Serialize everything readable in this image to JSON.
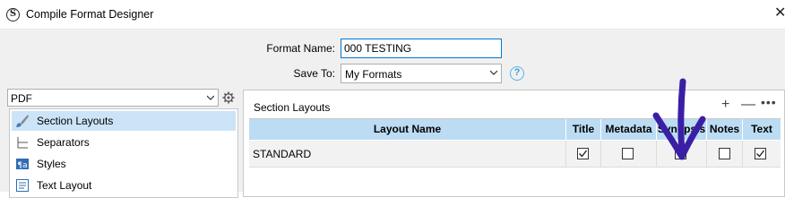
{
  "window": {
    "title": "Compile Format Designer",
    "app_icon": "scrivener-logo",
    "close_icon": "close-icon"
  },
  "form": {
    "format_name_label": "Format Name:",
    "format_name_value": "000 TESTING",
    "save_to_label": "Save To:",
    "save_to_value": "My Formats",
    "help_icon": "?"
  },
  "left": {
    "output_select_value": "PDF",
    "items": [
      {
        "label": "Section Layouts",
        "icon": "brush-icon",
        "selected": true
      },
      {
        "label": "Separators",
        "icon": "separator-icon",
        "selected": false
      },
      {
        "label": "Styles",
        "icon": "styles-icon",
        "selected": false
      },
      {
        "label": "Text Layout",
        "icon": "text-layout-icon",
        "selected": false
      }
    ]
  },
  "right": {
    "title": "Section Layouts",
    "add_label": "+",
    "remove_label": "—",
    "more_label": "•••",
    "columns": [
      "Layout Name",
      "Title",
      "Metadata",
      "Synopsis",
      "Notes",
      "Text"
    ],
    "rows": [
      {
        "name": "STANDARD",
        "title": true,
        "metadata": false,
        "synopsis": true,
        "notes": false,
        "text": true
      }
    ]
  },
  "colors": {
    "header_bg": "#bcdcf4",
    "selected_bg": "#cce4f7",
    "annotation": "#3a1fa6",
    "focus_border": "#0078d7"
  }
}
